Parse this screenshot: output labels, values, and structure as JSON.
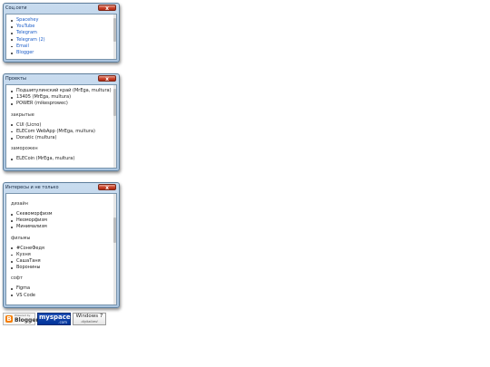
{
  "windows": {
    "social": {
      "title": "Соц.сети",
      "close_label": "x",
      "items": [
        "Spacehey",
        "YouTube",
        "Telegram",
        "Telegram (2)",
        "Email",
        "Blogger"
      ]
    },
    "projects": {
      "title": "Проекты",
      "close_label": "x",
      "active_items": [
        "Подшипулинский край (MrEga, multura)",
        "13405 (MrEga, multura)",
        "POWER (mikesprowec)"
      ],
      "closed_heading": "закрытые",
      "closed_items": [
        "CUI (Licno)",
        "ELECom WebApp (MrEga, multura)",
        "Donatic (multura)"
      ],
      "frozen_heading": "заморожен",
      "frozen_items": [
        "ELECoin (MrEga, multura)"
      ]
    },
    "interests": {
      "title": "Интересы и не только",
      "close_label": "x",
      "design_heading": "дизайн",
      "design_items": [
        "Скевоморфизм",
        "Неоморфизм",
        "Минимализм"
      ],
      "films_heading": "фильмы",
      "films_items": [
        "#СонеФедя",
        "Кухня",
        "СашаТаня",
        "Воронины"
      ],
      "soft_heading": "софт",
      "soft_items": [
        "Figma",
        "VS Code"
      ]
    }
  },
  "badges": {
    "blogger_top": "Powered by",
    "blogger_text": "Blogger",
    "myspace_text": "myspace",
    "myspace_sub": ".com",
    "windows_text": "Windows 7",
    "windows_sub": "digitalized"
  },
  "colors": {
    "link": "#1a5cc8",
    "title_gradient_top": "#c9dcef",
    "title_gradient_bottom": "#a9c4df",
    "close_red": "#c8432b",
    "myspace_blue": "#003399",
    "blogger_orange": "#f57d00"
  }
}
